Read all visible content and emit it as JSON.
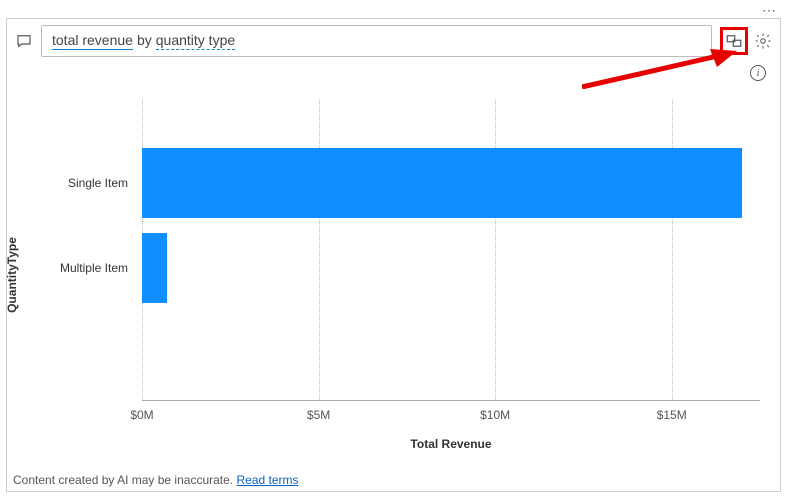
{
  "menu": {
    "ellipsis": "⋯"
  },
  "query": {
    "part1": "total revenue",
    "part2": "by",
    "part3": "quantity type"
  },
  "footer": {
    "text": "Content created by AI may be inaccurate.",
    "link": "Read terms"
  },
  "chart_data": {
    "type": "bar",
    "orientation": "horizontal",
    "title": "",
    "xlabel": "Total Revenue",
    "ylabel": "QuantityType",
    "xlim": [
      0,
      17500000
    ],
    "x_ticks": [
      {
        "value": 0,
        "label": "$0M"
      },
      {
        "value": 5000000,
        "label": "$5M"
      },
      {
        "value": 10000000,
        "label": "$10M"
      },
      {
        "value": 15000000,
        "label": "$15M"
      }
    ],
    "categories": [
      "Single Item",
      "Multiple Item"
    ],
    "values": [
      17000000,
      700000
    ],
    "bar_color": "#118dff"
  }
}
